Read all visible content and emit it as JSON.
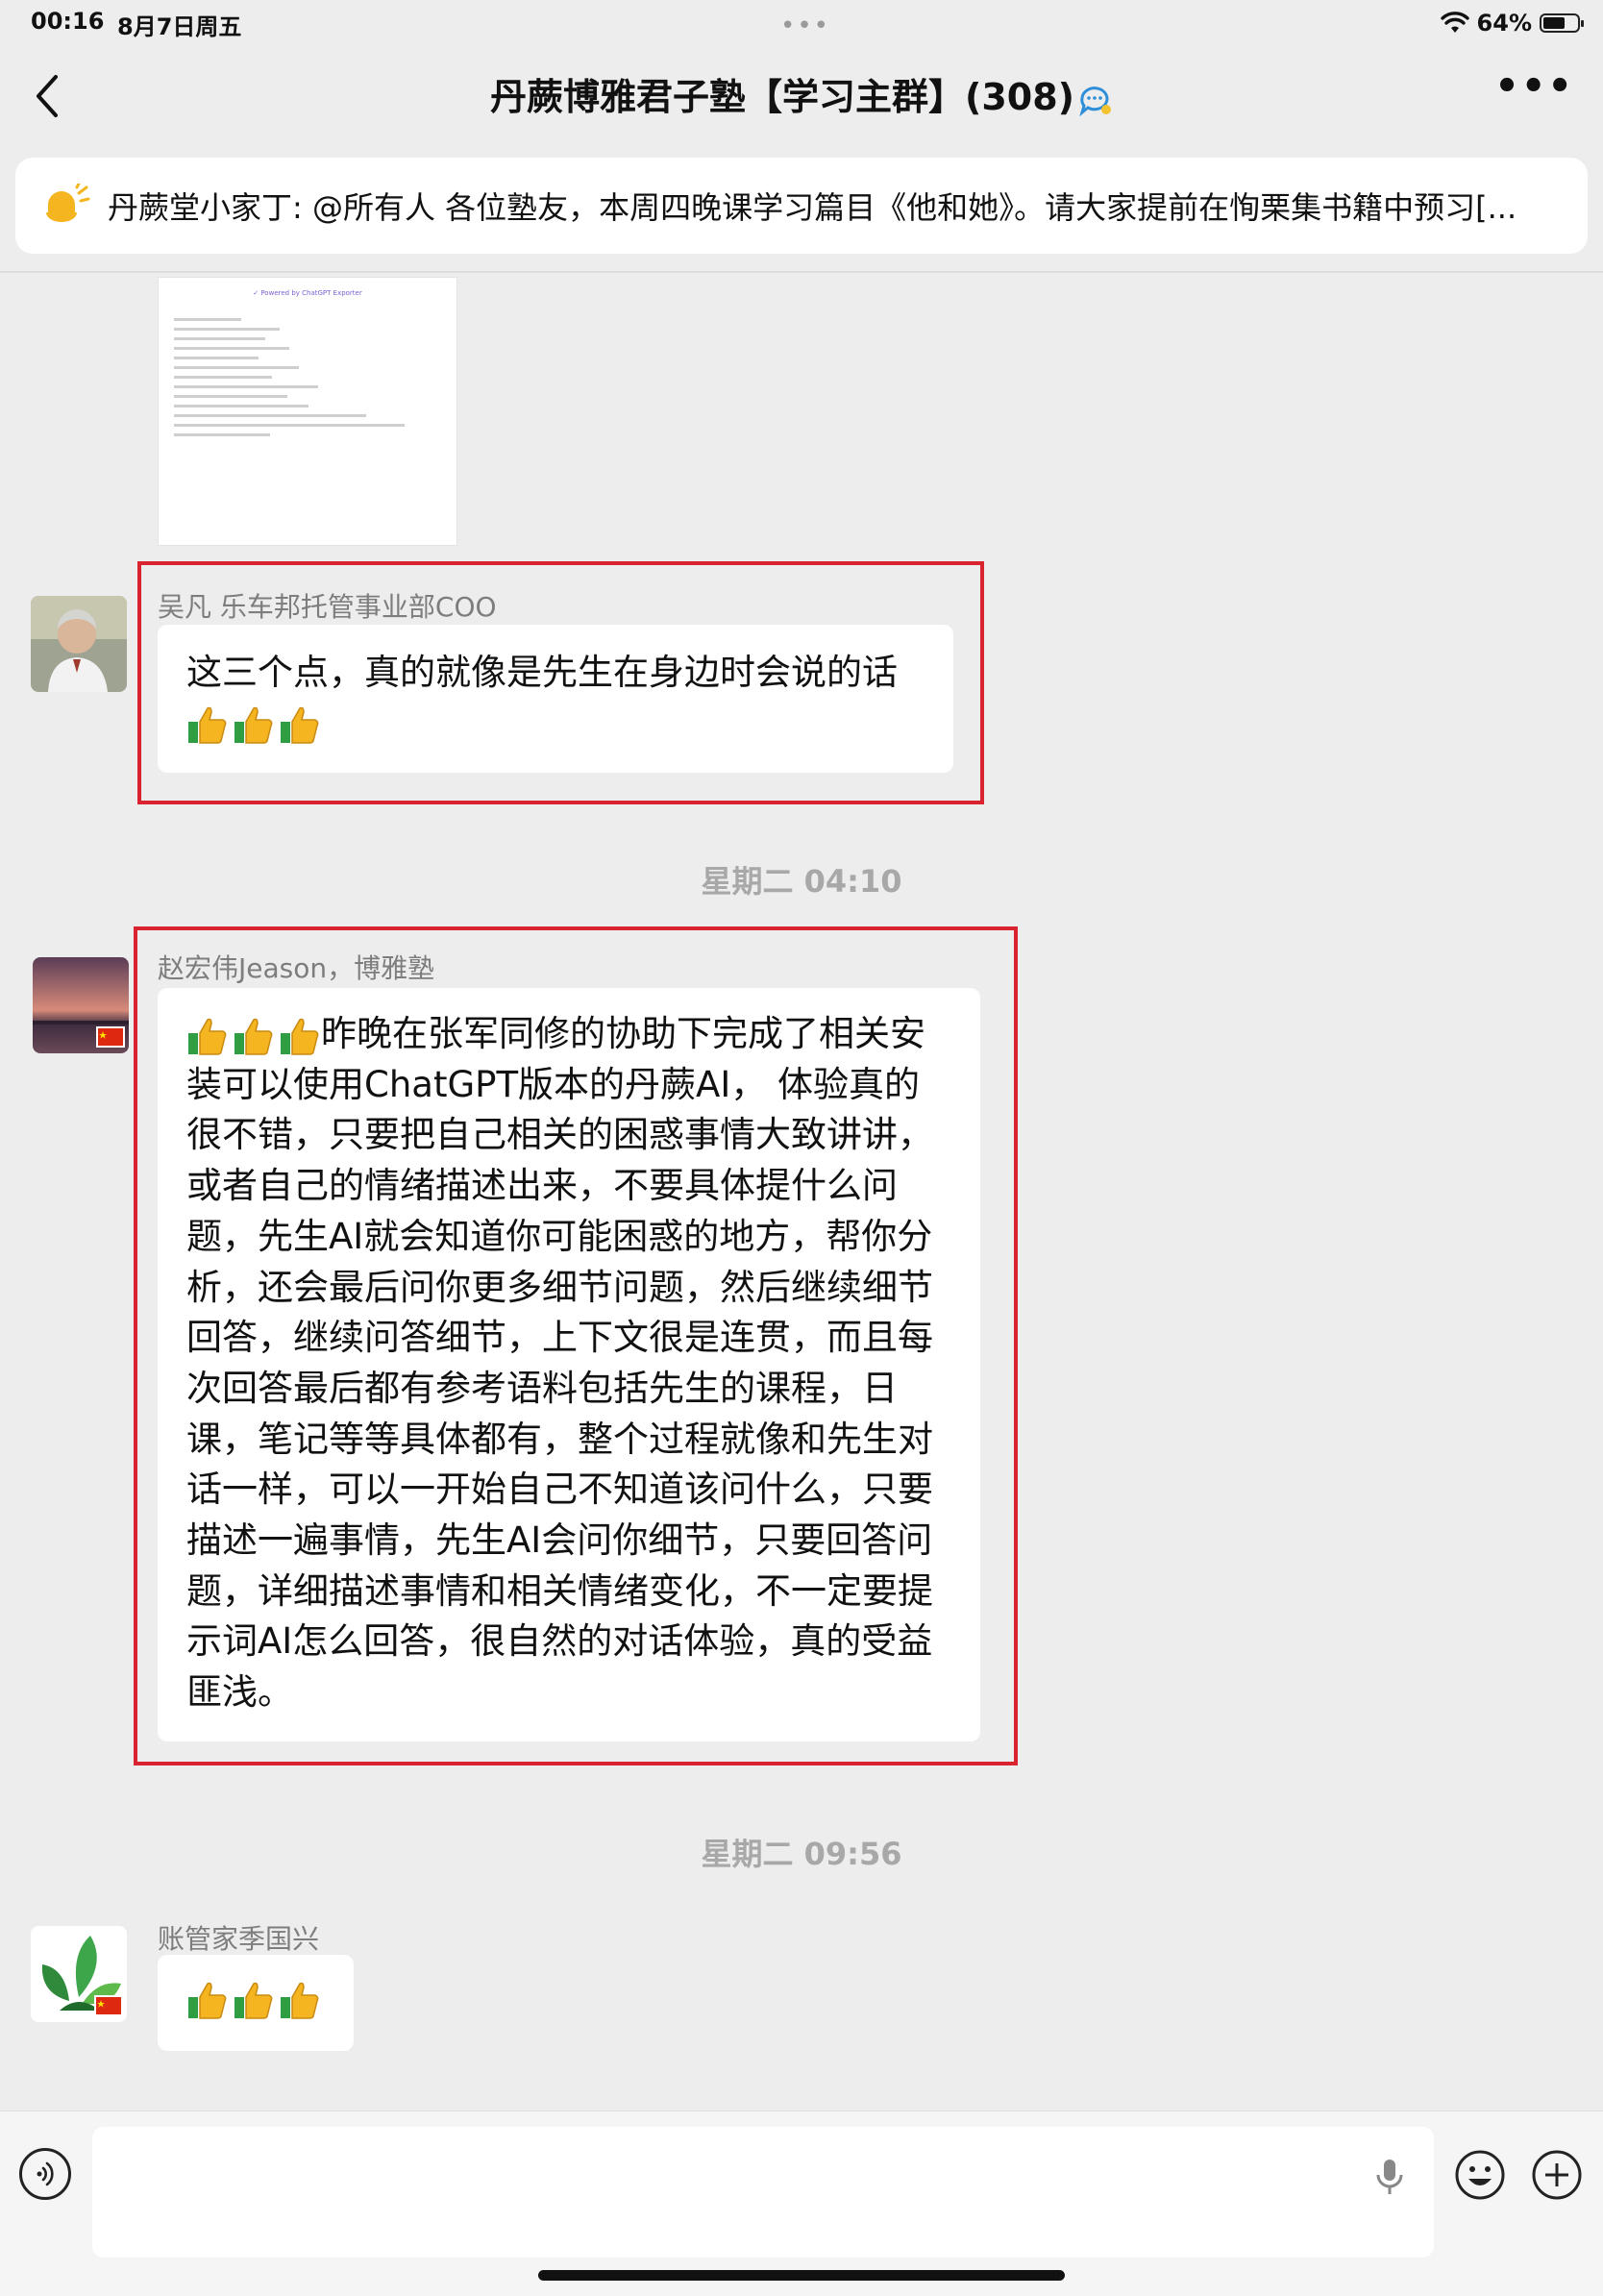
{
  "status_bar": {
    "time": "00:16",
    "date": "8月7日周五",
    "battery": "64%",
    "battery_level": 0.64
  },
  "nav": {
    "title": "丹蕨博雅君子塾【学习主群】(308)"
  },
  "announcement": {
    "text": "丹蕨堂小家丁: @所有人 各位塾友，本周四晚课学习篇目《他和她》。请大家提前在恂栗集书籍中预习[..."
  },
  "image_message": {
    "header": "✓ Powered by ChatGPT Exporter"
  },
  "messages": [
    {
      "sender": "吴凡 乐车邦托管事业部COO",
      "text": "这三个点，真的就像是先生在身边时会说的话",
      "thumbs_count": 3
    },
    {
      "sender": "赵宏伟Jeason，博雅塾",
      "text": "昨晚在张军同修的协助下完成了相关安装可以使用ChatGPT版本的丹蕨AI， 体验真的很不错，只要把自己相关的困惑事情大致讲讲，或者自己的情绪描述出来，不要具体提什么问题，先生AI就会知道你可能困惑的地方，帮你分析，还会最后问你更多细节问题，然后继续细节回答，继续问答细节，上下文很是连贯，而且每次回答最后都有参考语料包括先生的课程，日课，笔记等等具体都有，整个过程就像和先生对话一样，可以一开始自己不知道该问什么，只要描述一遍事情，先生AI会问你细节，只要回答问题，详细描述事情和相关情绪变化，不一定要提示词AI怎么回答，很自然的对话体验，真的受益匪浅。",
      "thumbs_count": 3
    },
    {
      "sender": "账管家季国兴",
      "text": "",
      "thumbs_count": 3
    }
  ],
  "timestamps": [
    "星期二 04:10",
    "星期二 09:56"
  ],
  "input": {
    "placeholder": ""
  },
  "colors": {
    "background": "#ededed",
    "bubble": "#ffffff",
    "highlight_box": "#d9232e",
    "timestamp": "#a8a8a8",
    "sender": "#7d7d7d"
  },
  "icons": [
    "back-chevron-icon",
    "chat-bubble-icon",
    "more-dots-icon",
    "megaphone-icon",
    "voice-icon",
    "mic-icon",
    "emoji-icon",
    "plus-icon",
    "thumbs-up-icon",
    "china-flag-icon",
    "wifi-icon",
    "battery-icon"
  ]
}
